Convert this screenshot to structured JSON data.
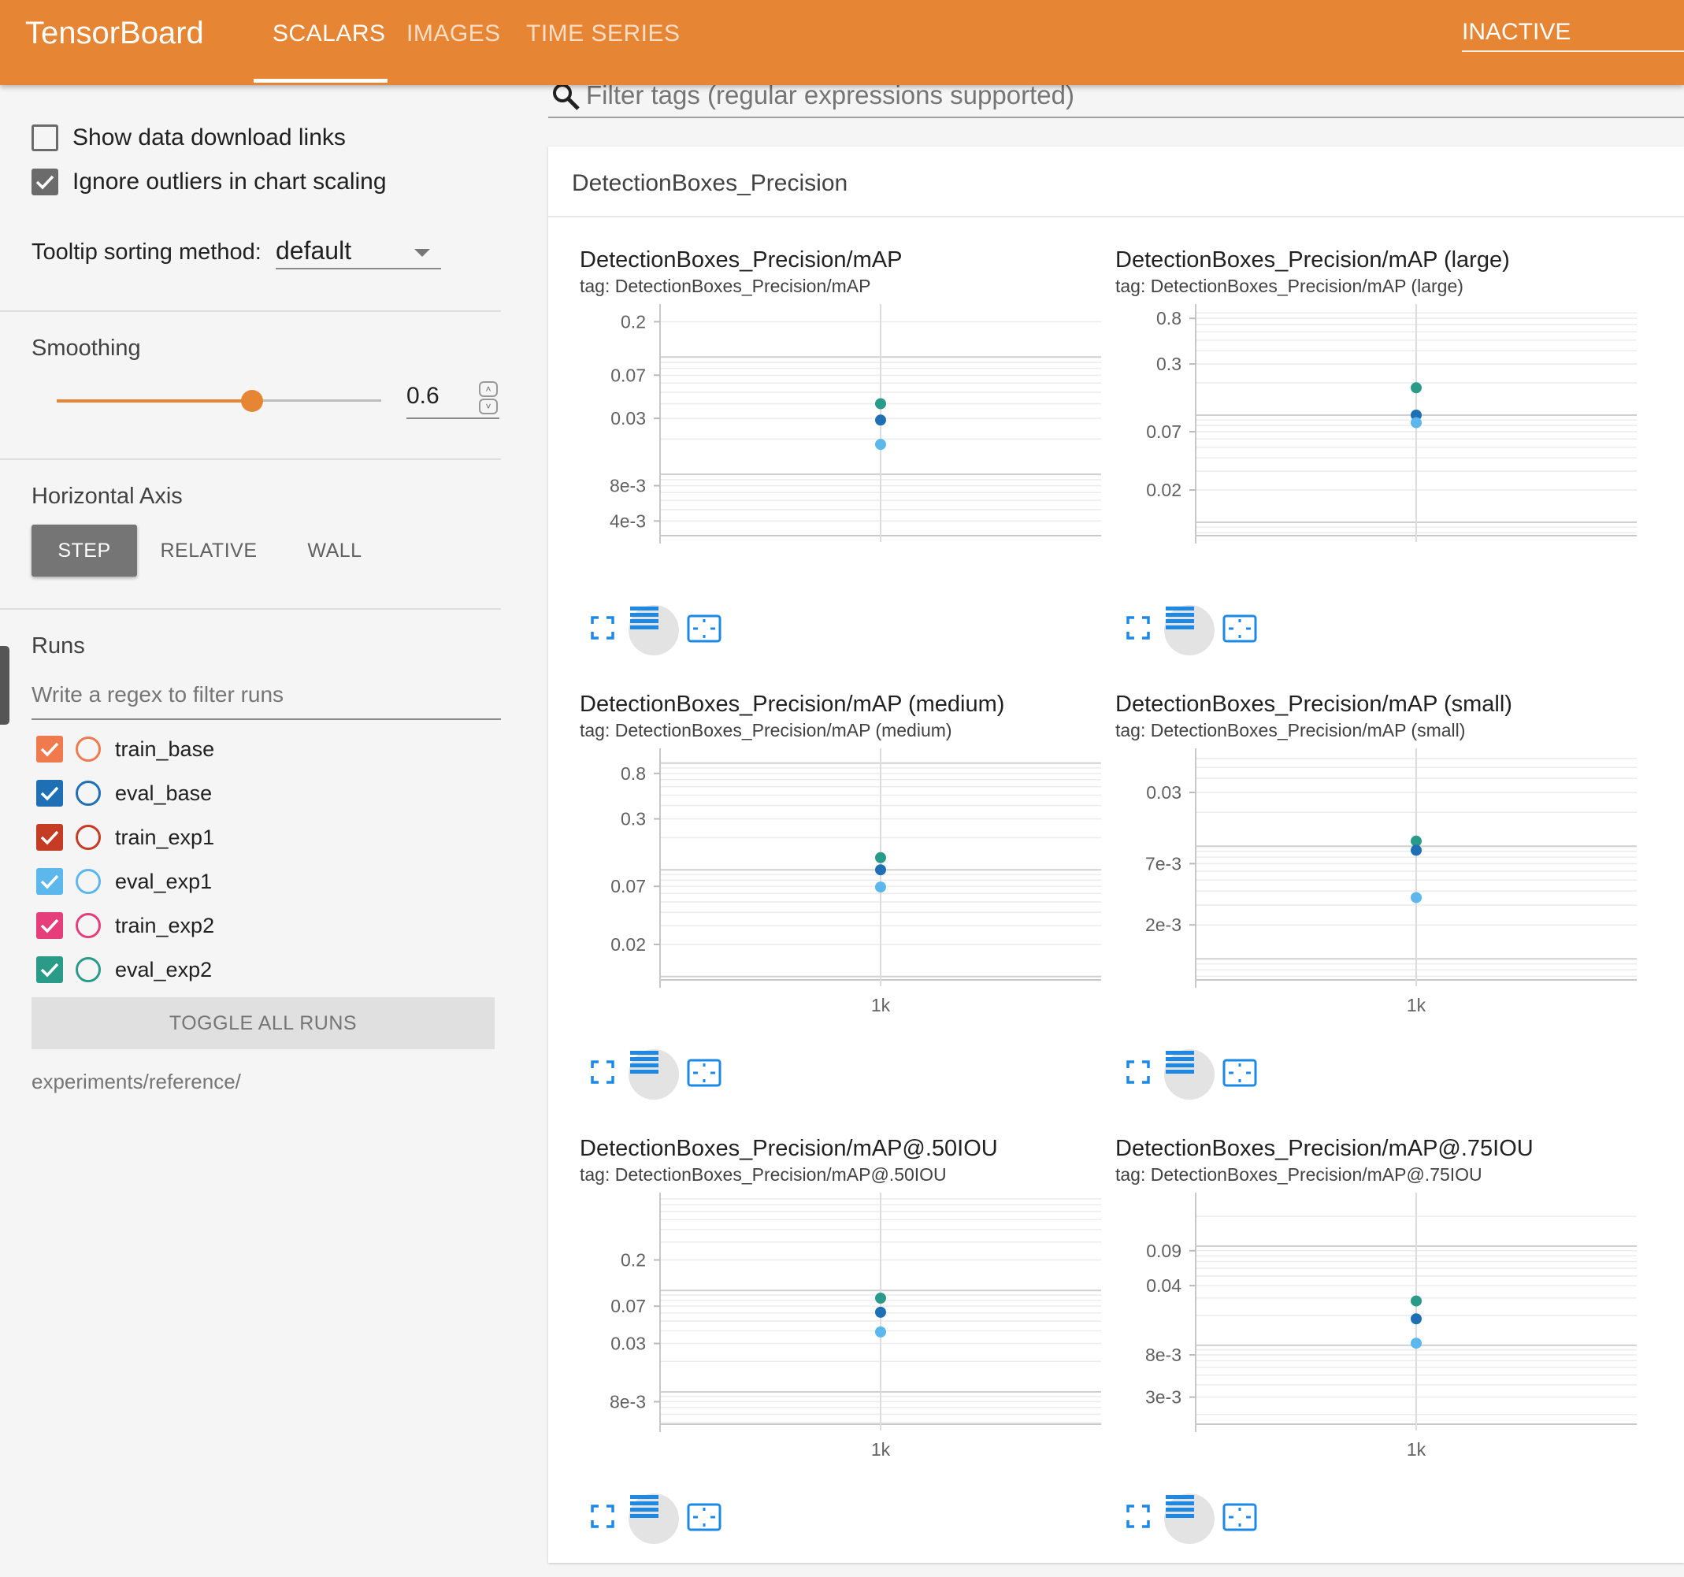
{
  "brand": "TensorBoard",
  "tabs": [
    {
      "label": "SCALARS"
    },
    {
      "label": "IMAGES"
    },
    {
      "label": "TIME SERIES"
    }
  ],
  "status": "INACTIVE",
  "sidebar": {
    "show_download": "Show data download links",
    "ignore_outliers": "Ignore outliers in chart scaling",
    "tooltip_label": "Tooltip sorting method:",
    "tooltip_value": "default",
    "smoothing_label": "Smoothing",
    "smoothing_value": "0.6",
    "smoothing_fraction": 0.6,
    "haxis_label": "Horizontal Axis",
    "haxis_options": [
      "STEP",
      "RELATIVE",
      "WALL"
    ],
    "runs_label": "Runs",
    "runs_filter_placeholder": "Write a regex to filter runs",
    "runs": [
      {
        "name": "train_base",
        "color": "#ef7a4e"
      },
      {
        "name": "eval_base",
        "color": "#1f6fb5"
      },
      {
        "name": "train_exp1",
        "color": "#c53b23"
      },
      {
        "name": "eval_exp1",
        "color": "#5bb7ec"
      },
      {
        "name": "train_exp2",
        "color": "#e63d7b"
      },
      {
        "name": "eval_exp2",
        "color": "#2a9a89"
      }
    ],
    "toggle_all": "TOGGLE ALL RUNS",
    "logdir": "experiments/reference/"
  },
  "filter_placeholder": "Filter tags (regular expressions supported)",
  "section_title": "DetectionBoxes_Precision",
  "chart_data": [
    {
      "type": "scatter",
      "title": "DetectionBoxes_Precision/mAP",
      "tag": "tag: DetectionBoxes_Precision/mAP",
      "yscale": "log",
      "yticks": [
        "0.2",
        "0.07",
        "0.03",
        "8e-3",
        "4e-3"
      ],
      "ytick_values": [
        0.2,
        0.07,
        0.03,
        0.008,
        0.004
      ],
      "xticks": [],
      "ylim": [
        0.003,
        0.25
      ],
      "series": [
        {
          "color": "#2a9a89",
          "x": [
            1000
          ],
          "y": [
            0.04
          ]
        },
        {
          "color": "#1f6fb5",
          "x": [
            1000
          ],
          "y": [
            0.029
          ]
        },
        {
          "color": "#5bb7ec",
          "x": [
            1000
          ],
          "y": [
            0.018
          ]
        }
      ]
    },
    {
      "type": "scatter",
      "title": "DetectionBoxes_Precision/mAP (large)",
      "tag": "tag: DetectionBoxes_Precision/mAP (large)",
      "yscale": "log",
      "yticks": [
        "0.8",
        "0.3",
        "0.07",
        "0.02"
      ],
      "ytick_values": [
        0.8,
        0.3,
        0.07,
        0.02
      ],
      "xticks": [],
      "ylim": [
        0.0075,
        0.95
      ],
      "series": [
        {
          "color": "#2a9a89",
          "x": [
            1000
          ],
          "y": [
            0.18
          ]
        },
        {
          "color": "#1f6fb5",
          "x": [
            1000
          ],
          "y": [
            0.1
          ]
        },
        {
          "color": "#5bb7ec",
          "x": [
            1000
          ],
          "y": [
            0.085
          ]
        }
      ]
    },
    {
      "type": "scatter",
      "title": "DetectionBoxes_Precision/mAP (medium)",
      "tag": "tag: DetectionBoxes_Precision/mAP (medium)",
      "yscale": "log",
      "yticks": [
        "0.8",
        "0.3",
        "0.07",
        "0.02"
      ],
      "ytick_values": [
        0.8,
        0.3,
        0.07,
        0.02
      ],
      "xticks": [
        "1k"
      ],
      "ylim": [
        0.0093,
        1.2
      ],
      "series": [
        {
          "color": "#2a9a89",
          "x": [
            1000
          ],
          "y": [
            0.13
          ]
        },
        {
          "color": "#1f6fb5",
          "x": [
            1000
          ],
          "y": [
            0.1
          ]
        },
        {
          "color": "#5bb7ec",
          "x": [
            1000
          ],
          "y": [
            0.069
          ]
        }
      ]
    },
    {
      "type": "scatter",
      "title": "DetectionBoxes_Precision/mAP (small)",
      "tag": "tag: DetectionBoxes_Precision/mAP (small)",
      "yscale": "log",
      "yticks": [
        "0.03",
        "7e-3",
        "2e-3"
      ],
      "ytick_values": [
        0.03,
        0.007,
        0.002
      ],
      "xticks": [
        "1k"
      ],
      "ylim": [
        0.00065,
        0.065
      ],
      "series": [
        {
          "color": "#2a9a89",
          "x": [
            1000
          ],
          "y": [
            0.0111
          ]
        },
        {
          "color": "#1f6fb5",
          "x": [
            1000
          ],
          "y": [
            0.0092
          ]
        },
        {
          "color": "#5bb7ec",
          "x": [
            1000
          ],
          "y": [
            0.0035
          ]
        }
      ]
    },
    {
      "type": "scatter",
      "title": "DetectionBoxes_Precision/mAP@.50IOU",
      "tag": "tag: DetectionBoxes_Precision/mAP@.50IOU",
      "yscale": "log",
      "yticks": [
        "0.2",
        "0.07",
        "0.03",
        "8e-3"
      ],
      "ytick_values": [
        0.2,
        0.07,
        0.03,
        0.008
      ],
      "xticks": [
        "1k"
      ],
      "ylim": [
        0.0048,
        0.8
      ],
      "series": [
        {
          "color": "#2a9a89",
          "x": [
            1000
          ],
          "y": [
            0.084
          ]
        },
        {
          "color": "#1f6fb5",
          "x": [
            1000
          ],
          "y": [
            0.061
          ]
        },
        {
          "color": "#5bb7ec",
          "x": [
            1000
          ],
          "y": [
            0.039
          ]
        }
      ]
    },
    {
      "type": "scatter",
      "title": "DetectionBoxes_Precision/mAP@.75IOU",
      "tag": "tag: DetectionBoxes_Precision/mAP@.75IOU",
      "yscale": "log",
      "yticks": [
        "0.09",
        "0.04",
        "8e-3",
        "3e-3"
      ],
      "ytick_values": [
        0.09,
        0.04,
        0.008,
        0.003
      ],
      "xticks": [
        "1k"
      ],
      "ylim": [
        0.0016,
        0.3
      ],
      "series": [
        {
          "color": "#2a9a89",
          "x": [
            1000
          ],
          "y": [
            0.028
          ]
        },
        {
          "color": "#1f6fb5",
          "x": [
            1000
          ],
          "y": [
            0.0185
          ]
        },
        {
          "color": "#5bb7ec",
          "x": [
            1000
          ],
          "y": [
            0.0105
          ]
        }
      ]
    }
  ]
}
